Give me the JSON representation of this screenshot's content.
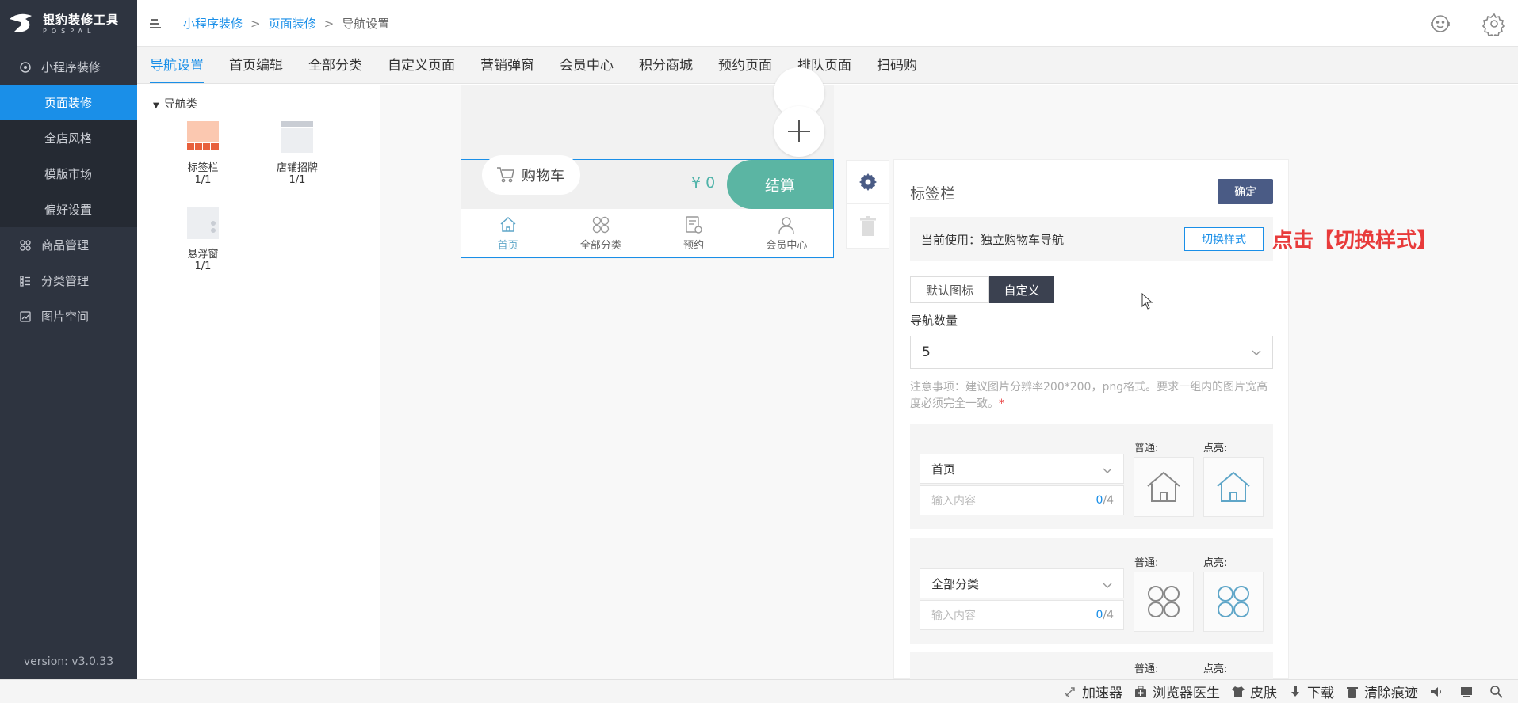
{
  "app": {
    "logo_title": "银豹装修工具",
    "logo_sub": "POSPAL",
    "version": "version: v3.0.33"
  },
  "sidebar": {
    "items": [
      {
        "label": "小程序装修",
        "icon": "circle-icon"
      },
      {
        "label": "页面装修",
        "active": true
      },
      {
        "label": "全店风格"
      },
      {
        "label": "模版市场"
      },
      {
        "label": "偏好设置"
      },
      {
        "label": "商品管理",
        "icon": "grid-icon"
      },
      {
        "label": "分类管理",
        "icon": "list-icon"
      },
      {
        "label": "图片空间",
        "icon": "image-icon"
      }
    ]
  },
  "breadcrumb": {
    "b1": "小程序装修",
    "b2": "页面装修",
    "b3": "导航设置",
    "sep": ">"
  },
  "tabs": [
    "导航设置",
    "首页编辑",
    "全部分类",
    "自定义页面",
    "营销弹窗",
    "会员中心",
    "积分商城",
    "预约页面",
    "排队页面",
    "扫码购"
  ],
  "components": {
    "group": "导航类",
    "items": [
      {
        "name": "标签栏",
        "count": "1/1"
      },
      {
        "name": "店铺招牌",
        "count": "1/1"
      },
      {
        "name": "悬浮窗",
        "count": "1/1"
      }
    ]
  },
  "preview": {
    "cart": "购物车",
    "price": "¥ 0",
    "settle": "结算",
    "nav": [
      "首页",
      "全部分类",
      "预约",
      "会员中心"
    ]
  },
  "panel": {
    "title": "标签栏",
    "ok": "确定",
    "current": "当前使用：独立购物车导航",
    "switch": "切换样式",
    "hint": "点击【切换样式】",
    "seg_default": "默认图标",
    "seg_custom": "自定义",
    "nav_count_label": "导航数量",
    "nav_count": "5",
    "note": "注意事项：建议图片分辨率200*200，png格式。要求一组内的图片宽高度必须完全一致。",
    "note_star": "*",
    "normal": "普通:",
    "highlight": "点亮:",
    "input_placeholder": "输入内容",
    "cards": [
      {
        "name": "首页",
        "count": "0",
        "max": "/4"
      },
      {
        "name": "全部分类",
        "count": "0",
        "max": "/4"
      }
    ]
  },
  "statusbar": [
    "加速器",
    "浏览器医生",
    "皮肤",
    "下载",
    "清除痕迹"
  ],
  "colors": {
    "accent": "#1a8fe8",
    "sidebar": "#2e3440",
    "teal": "#5bb5a3",
    "hint": "#e83b3b",
    "navy": "#4a5b85"
  }
}
